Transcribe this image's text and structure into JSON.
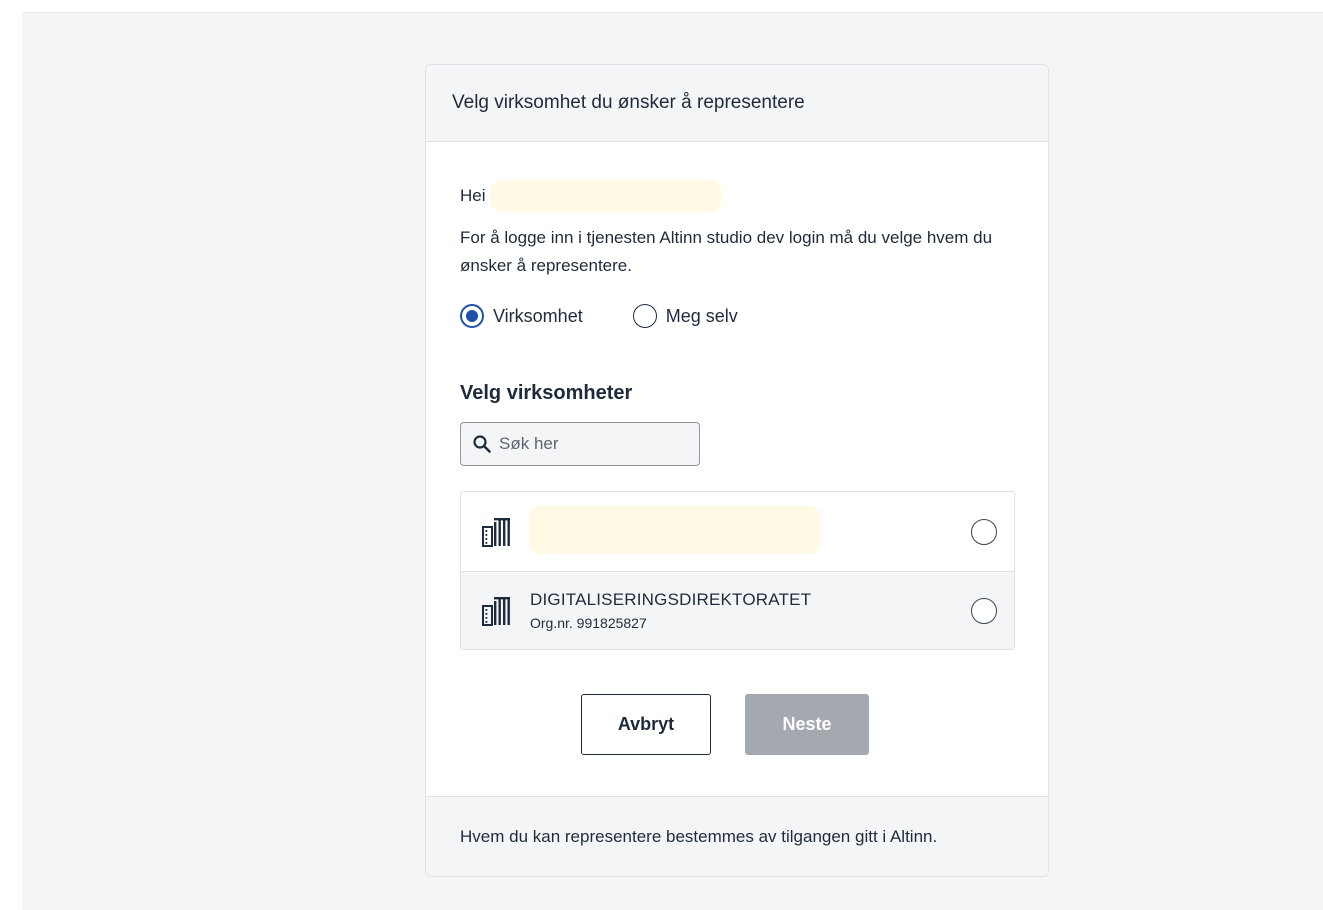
{
  "card": {
    "title": "Velg virksomhet du ønsker å representere"
  },
  "greeting": {
    "label": "Hei"
  },
  "intro": {
    "text": "For å logge inn i tjenesten Altinn studio dev login må du velge hvem du ønsker å representere."
  },
  "represent_options": [
    {
      "label": "Virksomhet",
      "selected": true
    },
    {
      "label": "Meg selv",
      "selected": false
    }
  ],
  "org_section": {
    "title": "Velg virksomheter",
    "search_placeholder": "Søk her"
  },
  "organizations": [
    {
      "name": "",
      "org_nr": "",
      "selected": false
    },
    {
      "name": "DIGITALISERINGSDIREKTORATET",
      "org_nr": "Org.nr. 991825827",
      "selected": false
    }
  ],
  "actions": {
    "cancel_label": "Avbryt",
    "next_label": "Neste"
  },
  "footer": {
    "text": "Hvem du kan representere bestemmes av tilgangen gitt i Altinn."
  },
  "icons": {
    "search": "search-icon",
    "organization": "building-icon"
  },
  "colors": {
    "accent": "#1e4fa8",
    "disabled_button": "#a4a9b0",
    "redaction": "#fff9e5",
    "background": "#f4f5f6"
  }
}
